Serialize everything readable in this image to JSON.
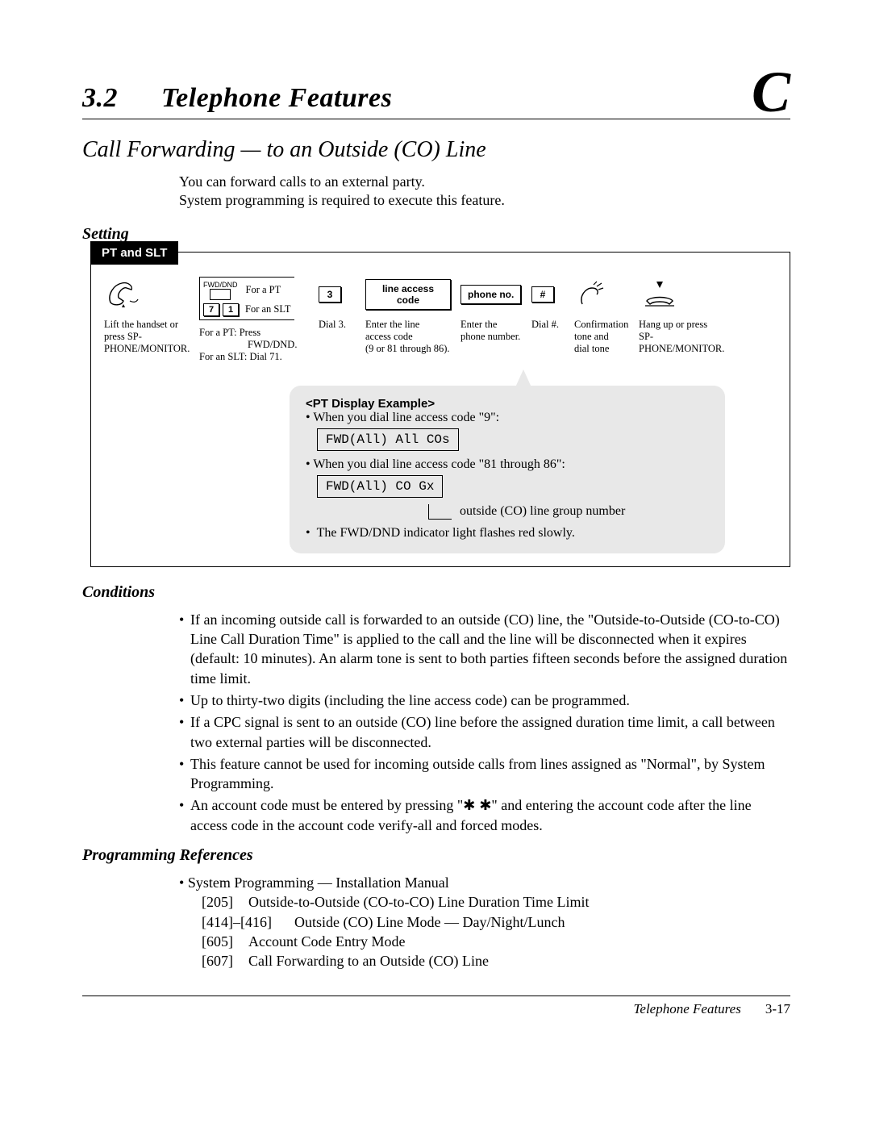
{
  "header": {
    "num": "3.2",
    "title": "Telephone Features",
    "letter": "C"
  },
  "subtitle": "Call Forwarding — to an Outside (CO) Line",
  "intro": {
    "l1": "You can forward calls to an external party.",
    "l2": "System programming is required to execute this feature."
  },
  "setting": {
    "h": "Setting",
    "tab": "PT and SLT",
    "fwd_dnd": "FWD/DND",
    "for_pt": "For a PT",
    "for_slt": "For an SLT",
    "k7": "7",
    "k1": "1",
    "k3": "3",
    "klac": "line access code",
    "kph": "phone no.",
    "khash": "#",
    "cap1": "Lift the handset or press SP-PHONE/MONITOR.",
    "cap2a": "For a PT: Press",
    "cap2b": "FWD/DND.",
    "cap2c": "For an SLT: Dial 71.",
    "cap3": "Dial 3.",
    "cap4a": "Enter the line",
    "cap4b": "access code",
    "cap4c": "(9 or 81 through 86).",
    "cap5a": "Enter the",
    "cap5b": "phone number.",
    "cap6": "Dial #.",
    "cap7a": "Confirmation",
    "cap7b": "tone and",
    "cap7c": "dial tone",
    "cap8a": "Hang up or press",
    "cap8b": "SP-PHONE/MONITOR."
  },
  "callout": {
    "title": "<PT Display Example>",
    "l1": "When you dial line access code \"9\":",
    "d1": "FWD(All) All COs",
    "l2": "When you dial line access code \"81 through 86\":",
    "d2": "FWD(All) CO Gx",
    "legend": "outside (CO) line group number",
    "l3": "The FWD/DND indicator light flashes red slowly."
  },
  "conditions": {
    "h": "Conditions",
    "b1": "If an incoming outside call is forwarded to an outside (CO) line, the \"Outside-to-Outside (CO-to-CO) Line Call Duration Time\" is applied to the call and the line will be disconnected when it expires (default: 10 minutes). An alarm tone is sent to both parties fifteen seconds before the assigned duration time limit.",
    "b2": "Up to thirty-two digits (including the line access code) can be programmed.",
    "b3": "If a CPC signal is sent to an outside (CO) line before the assigned duration time limit, a call between two external parties will be disconnected.",
    "b4": "This feature cannot be used for incoming outside calls from lines assigned as \"Normal\", by System Programming.",
    "b5a": "An account code must be entered by pressing \"",
    "b5b": "\" and entering the account code after the line access code in the account code verify-all and forced modes.",
    "star": "✱ ✱"
  },
  "refs": {
    "h": "Programming References",
    "b1": "System Programming — Installation Manual",
    "r1c": "[205]",
    "r1t": "Outside-to-Outside (CO-to-CO) Line Duration Time Limit",
    "r2c": "[414]–[416]",
    "r2t": "Outside (CO) Line Mode — Day/Night/Lunch",
    "r3c": "[605]",
    "r3t": "Account Code Entry Mode",
    "r4c": "[607]",
    "r4t": "Call Forwarding to an Outside (CO) Line"
  },
  "footer": {
    "t": "Telephone Features",
    "p": "3-17"
  }
}
